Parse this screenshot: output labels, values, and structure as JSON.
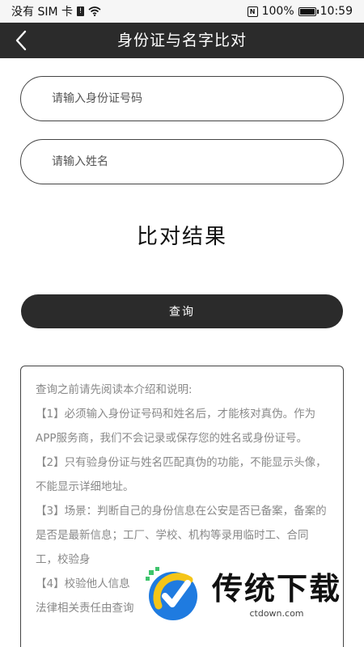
{
  "status_bar": {
    "carrier": "没有 SIM 卡",
    "sim_badge": "!",
    "nfc": "N",
    "battery": "100%",
    "time": "10:59"
  },
  "header": {
    "title": "身份证与名字比对"
  },
  "form": {
    "id_placeholder": "请输入身份证号码",
    "name_placeholder": "请输入姓名"
  },
  "result": {
    "heading": "比对结果"
  },
  "actions": {
    "query_label": "查询"
  },
  "notice": {
    "lines": [
      "查询之前请先阅读本介绍和说明:",
      "【1】必须输入身份证号码和姓名后，才能核对真伪。作为APP服务商，我们不会记录或保存您的姓名或身份证号。",
      "【2】只有验身份证与姓名匹配真伪的功能，不能显示头像，不能显示详细地址。",
      "【3】场景：判断自己的身份信息在公安是否已备案，备案的是否是最新信息；工厂、学校、机构等录用临时工、合同工，校验身",
      "【4】校验他人信息",
      "法律相关责任由查询"
    ]
  },
  "watermark": {
    "brand": "传统下载",
    "url": "ctdown.com"
  }
}
